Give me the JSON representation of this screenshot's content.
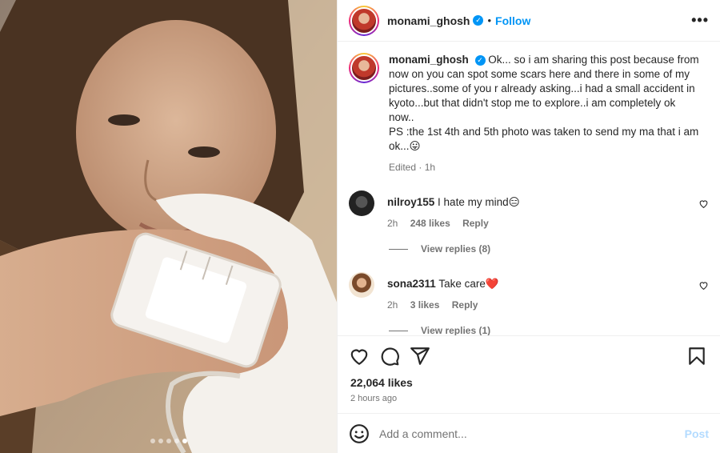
{
  "post": {
    "author": "monami_ghosh",
    "follow_label": "Follow",
    "separator": "•",
    "more_label": "•••",
    "caption_text": "Ok... so i am sharing this post because from now on you can spot some scars here and there in some of my pictures..some of you r already asking...i had a small accident in kyoto...but that didn't stop me to explore..i am completely ok now..\nPS :the 1st 4th and 5th photo was taken to send my ma that i am ok...😛",
    "caption_meta": "Edited · 1h",
    "likes": "22,064 likes",
    "time": "2 hours ago",
    "carousel": {
      "count": 5,
      "active_index": 4
    }
  },
  "comments": [
    {
      "user": "nilroy155",
      "text": "I hate my mind😑",
      "age": "2h",
      "likes": "248 likes",
      "reply_label": "Reply",
      "view_replies": "View replies (8)"
    },
    {
      "user": "sona2311",
      "text": "Take care❤️",
      "age": "2h",
      "likes": "3 likes",
      "reply_label": "Reply",
      "view_replies": "View replies (1)"
    }
  ],
  "composer": {
    "placeholder": "Add a comment...",
    "post_label": "Post"
  },
  "colors": {
    "accent": "#0095f6",
    "post_disabled": "#b3dbff",
    "muted": "#737373"
  },
  "icons": [
    "heart-icon",
    "comment-icon",
    "share-icon",
    "bookmark-icon",
    "emoji-icon",
    "verified-icon",
    "more-icon"
  ]
}
